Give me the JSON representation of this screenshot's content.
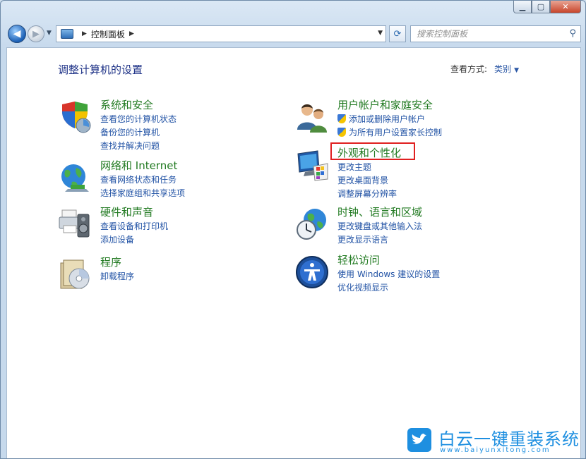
{
  "window": {
    "minimize_glyph": "▁",
    "maximize_glyph": "▢",
    "close_glyph": "✕"
  },
  "nav": {
    "back_glyph": "◀",
    "forward_glyph": "▶",
    "breadcrumb": "控制面板",
    "search_placeholder": "搜索控制面板"
  },
  "page": {
    "title": "调整计算机的设置",
    "view_label": "查看方式:",
    "view_value": "类别"
  },
  "categories": [
    {
      "title": "系统和安全",
      "icon": "shield-flag-icon",
      "links": [
        "查看您的计算机状态",
        "备份您的计算机",
        "查找并解决问题"
      ]
    },
    {
      "title": "网络和 Internet",
      "icon": "network-globe-icon",
      "links": [
        "查看网络状态和任务",
        "选择家庭组和共享选项"
      ]
    },
    {
      "title": "硬件和声音",
      "icon": "printer-speaker-icon",
      "links": [
        "查看设备和打印机",
        "添加设备"
      ]
    },
    {
      "title": "程序",
      "icon": "programs-disc-icon",
      "links": [
        "卸载程序"
      ]
    },
    {
      "title": "用户帐户和家庭安全",
      "icon": "users-icon",
      "links": [
        "添加或删除用户帐户",
        "为所有用户设置家长控制"
      ]
    },
    {
      "title": "外观和个性化",
      "icon": "monitor-palette-icon",
      "links": [
        "更改主题",
        "更改桌面背景",
        "调整屏幕分辨率"
      ]
    },
    {
      "title": "时钟、语言和区域",
      "icon": "clock-globe-icon",
      "links": [
        "更改键盘或其他输入法",
        "更改显示语言"
      ]
    },
    {
      "title": "轻松访问",
      "icon": "ease-of-access-icon",
      "links": [
        "使用 Windows 建议的设置",
        "优化视频显示"
      ]
    }
  ],
  "watermark": {
    "name": "白云一键重装系统",
    "url": "www.baiyunxitong.com"
  },
  "colors": {
    "category_title": "#217a21",
    "link": "#2253a5",
    "highlight_border": "#e02020",
    "watermark": "#1e8fe0"
  }
}
